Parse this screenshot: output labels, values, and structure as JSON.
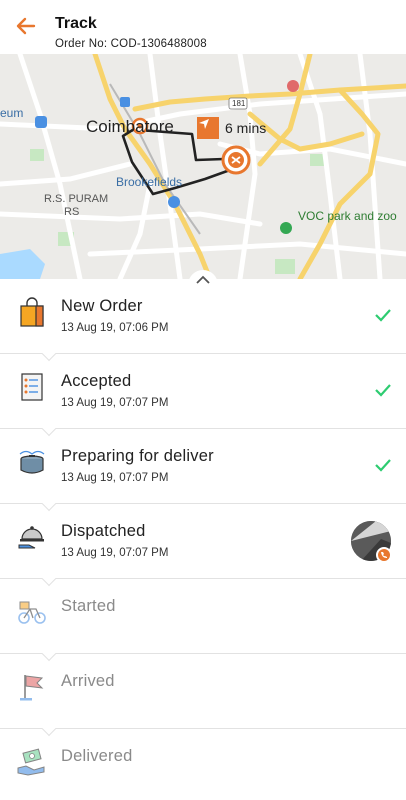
{
  "header": {
    "title": "Track",
    "order_no": "Order No: COD-1306488008"
  },
  "map": {
    "eta": "6 mins",
    "labels": {
      "city": "Coimbatore",
      "area1": "Brookefields",
      "area2": "R.S. PURAM",
      "area2b": "RS",
      "park": "VOC park and zoo",
      "museum": "eum",
      "road": "181"
    }
  },
  "steps": [
    {
      "label": "New Order",
      "time": "13 Aug 19, 07:06 PM",
      "status": "done",
      "icon": "shopping-bag-icon"
    },
    {
      "label": "Accepted",
      "time": "13 Aug 19, 07:07 PM",
      "status": "done",
      "icon": "checklist-icon"
    },
    {
      "label": "Preparing for deliver",
      "time": "13 Aug 19, 07:07 PM",
      "status": "done",
      "icon": "cooking-pot-icon"
    },
    {
      "label": "Dispatched",
      "time": "13 Aug 19, 07:07 PM",
      "status": "current",
      "icon": "serving-dish-icon"
    },
    {
      "label": "Started",
      "time": "",
      "status": "pending",
      "icon": "bicycle-icon"
    },
    {
      "label": "Arrived",
      "time": "",
      "status": "pending",
      "icon": "flag-icon"
    },
    {
      "label": "Delivered",
      "time": "",
      "status": "pending",
      "icon": "handing-money-icon"
    }
  ],
  "colors": {
    "accent": "#e8772e",
    "check": "#2ecc71",
    "divider": "#e2e2e2",
    "pending_text": "#8a8a8a"
  }
}
